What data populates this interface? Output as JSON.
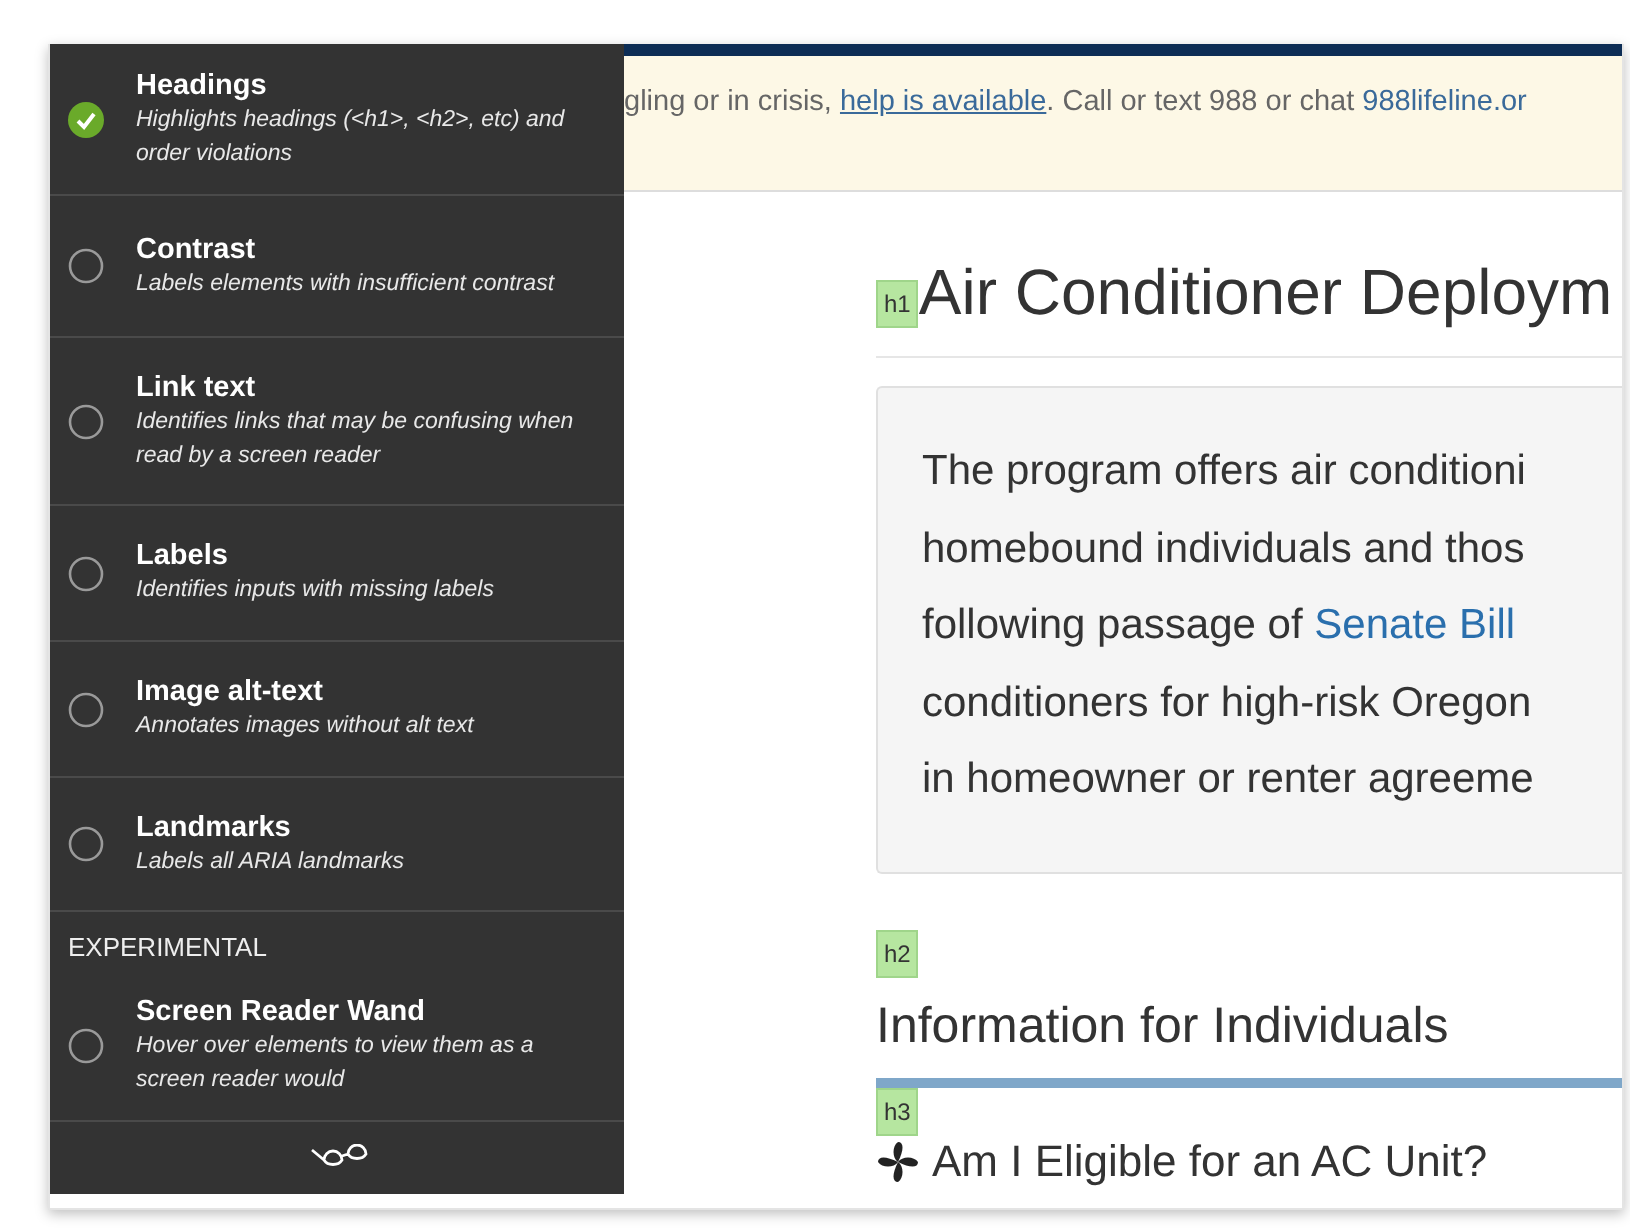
{
  "panel": {
    "options": [
      {
        "title": "Headings",
        "description": "Highlights headings (<h1>, <h2>, etc) and order violations",
        "checked": true
      },
      {
        "title": "Contrast",
        "description": "Labels elements with insufficient contrast",
        "checked": false
      },
      {
        "title": "Link text",
        "description": "Identifies links that may be confusing when read by a screen reader",
        "checked": false
      },
      {
        "title": "Labels",
        "description": "Identifies inputs with missing labels",
        "checked": false
      },
      {
        "title": "Image alt-text",
        "description": "Annotates images without alt text",
        "checked": false
      },
      {
        "title": "Landmarks",
        "description": "Labels all ARIA landmarks",
        "checked": false
      }
    ],
    "experimental": {
      "heading": "EXPERIMENTAL",
      "options": [
        {
          "title": "Screen Reader Wand",
          "description": "Hover over elements to view them as a screen reader would",
          "checked": false
        }
      ]
    }
  },
  "page": {
    "banner": {
      "text_before": "gling or in crisis, ",
      "link": "help is available",
      "text_middle": ". Call or text 988 or chat ",
      "link_2": "988lifeline.or"
    },
    "h1": {
      "badge": "h1",
      "text": "Air Conditioner Deploym"
    },
    "intro_lines": [
      {
        "text": "The program offers air conditioni"
      },
      {
        "text": "homebound individuals and thos"
      },
      {
        "text": "following passage of ",
        "link": "Senate Bill"
      },
      {
        "text": "conditioners for high-risk Oregon"
      },
      {
        "text": "in homeowner or renter agreeme"
      }
    ],
    "h2": {
      "badge": "h2",
      "text": "Information for Individuals"
    },
    "h3": {
      "badge": "h3",
      "text": "Am I Eligible for an AC Unit?"
    }
  }
}
